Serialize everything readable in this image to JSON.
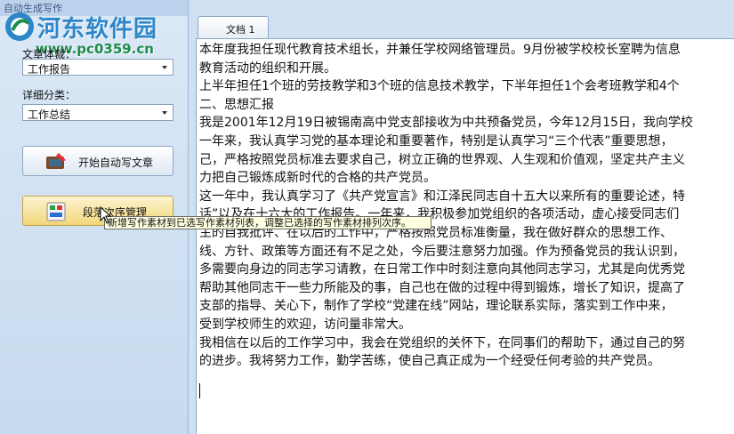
{
  "window": {
    "title": "自动生成写作"
  },
  "watermark": {
    "name": "河东软件园",
    "url": "www.pc0359.cn"
  },
  "left_panel": {
    "doc_type_label": "文章体裁：",
    "doc_type_value": "工作报告",
    "detail_label": "详细分类：",
    "detail_value": "工作总结",
    "auto_write_button": "开始自动写文章",
    "order_button": "段落次序管理",
    "tooltip": "新增写作素材到已选写作素材列表，调整已选择的写作素材排列次序。"
  },
  "document": {
    "tab_label": "文档 1",
    "lines": [
      "本年度我担任现代教育技术组长，并兼任学校网络管理员。9月份被学校校长室聘为信息",
      "教育活动的组织和开展。",
      "上半年担任1个班的劳技教学和3个班的信息技术教学，下半年担任1个会考班教学和4个",
      "二、思想汇报",
      "我是2001年12月19日被锡南高中党支部接收为中共预备党员，今年12月15日，我向学校",
      "一年来，我认真学习党的基本理论和重要著作，特别是认真学习“三个代表”重要思想，",
      "己，严格按照党员标准去要求自己，树立正确的世界观、人生观和价值观，坚定共产主义",
      "力把自己锻炼成新时代的合格的共产党员。",
      "这一年中，我认真学习了《共产党宣言》和江泽民同志自十五大以来所有的重要论述，特",
      "话”以及在十六大的工作报告。一年来，我积极参加党组织的各项活动，虚心接受同志们",
      "主的自我批评、在以后的工作中，严格按照党员标准衡量，我在做好群众的思想工作、",
      "线、方针、政策等方面还有不足之处，今后要注意努力加强。作为预备党员的我认识到，",
      "多需要向身边的同志学习请教，在日常工作中时刻注意向其他同志学习，尤其是向优秀党",
      "帮助其他同志干一些力所能及的事，自己也在做的过程中得到锻炼，增长了知识，提高了",
      "支部的指导、关心下，制作了学校“党建在线”网站，理论联系实际，落实到工作中来，",
      "受到学校师生的欢迎，访问量非常大。",
      "我相信在以后的工作学习中，我会在党组织的关怀下，在同事们的帮助下，通过自己的努",
      "的进步。我将努力工作，勤学苦练，使自己真正成为一个经受任何考验的共产党员。"
    ]
  }
}
